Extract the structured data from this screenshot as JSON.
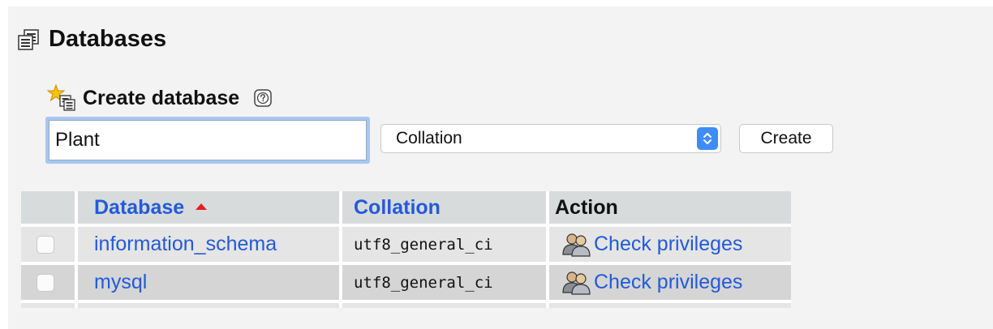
{
  "page": {
    "title": "Databases",
    "title_icon": "database-icon"
  },
  "create_section": {
    "title": "Create database",
    "icon": "new-database-icon",
    "help_icon": "help-icon",
    "name_input_value": "Plant",
    "collation_select_value": "Collation",
    "create_button_label": "Create"
  },
  "table": {
    "headers": {
      "database": "Database",
      "collation": "Collation",
      "action": "Action"
    },
    "sort_indicator": "sort-ascending-icon",
    "rows": [
      {
        "database": "information_schema",
        "collation": "utf8_general_ci",
        "action_label": "Check privileges",
        "action_icon": "users-privileges-icon"
      },
      {
        "database": "mysql",
        "collation": "utf8_general_ci",
        "action_label": "Check privileges",
        "action_icon": "users-privileges-icon"
      }
    ]
  },
  "colors": {
    "panel_background": "#f3f3f3",
    "link": "#235ad7",
    "header_background": "#d8dbdc",
    "row_odd": "#e5e5e5",
    "row_even": "#d5d5d5",
    "input_focus_ring": "#a7c7ef",
    "select_arrow_accent": "#3f8cf5",
    "sort_arrow": "#e02020"
  }
}
